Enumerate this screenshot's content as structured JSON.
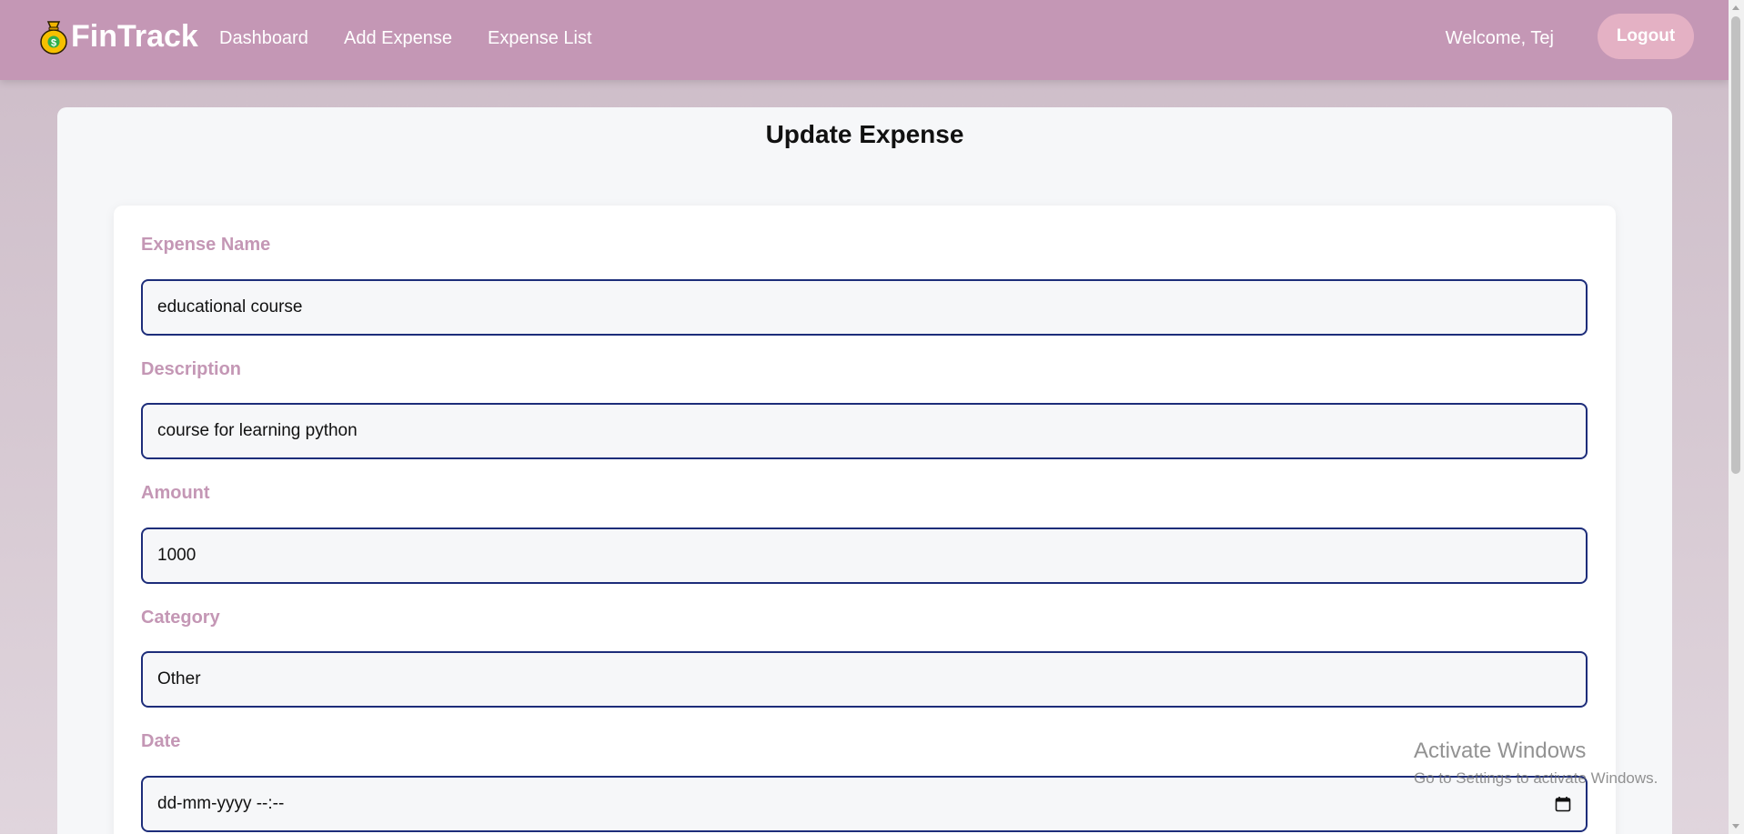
{
  "navbar": {
    "brand": "FinTrack",
    "brand_icon": "money-bag-icon",
    "links": [
      {
        "label": "Dashboard"
      },
      {
        "label": "Add Expense"
      },
      {
        "label": "Expense List"
      }
    ],
    "welcome": "Welcome, Tej",
    "logout_label": "Logout"
  },
  "colors": {
    "navbar": "#c497b5",
    "label": "#c497b5",
    "input_border": "#1d2d7a",
    "logout_bg": "#e4b1c4"
  },
  "page": {
    "title": "Update Expense"
  },
  "form": {
    "fields": [
      {
        "label": "Expense Name",
        "value": "educational course"
      },
      {
        "label": "Description",
        "value": "course for learning python"
      },
      {
        "label": "Amount",
        "value": "1000"
      },
      {
        "label": "Category",
        "value": "Other"
      },
      {
        "label": "Date",
        "value": "dd-mm-yyyy --:--"
      }
    ]
  },
  "watermark": {
    "title": "Activate Windows",
    "subtitle": "Go to Settings to activate Windows."
  }
}
